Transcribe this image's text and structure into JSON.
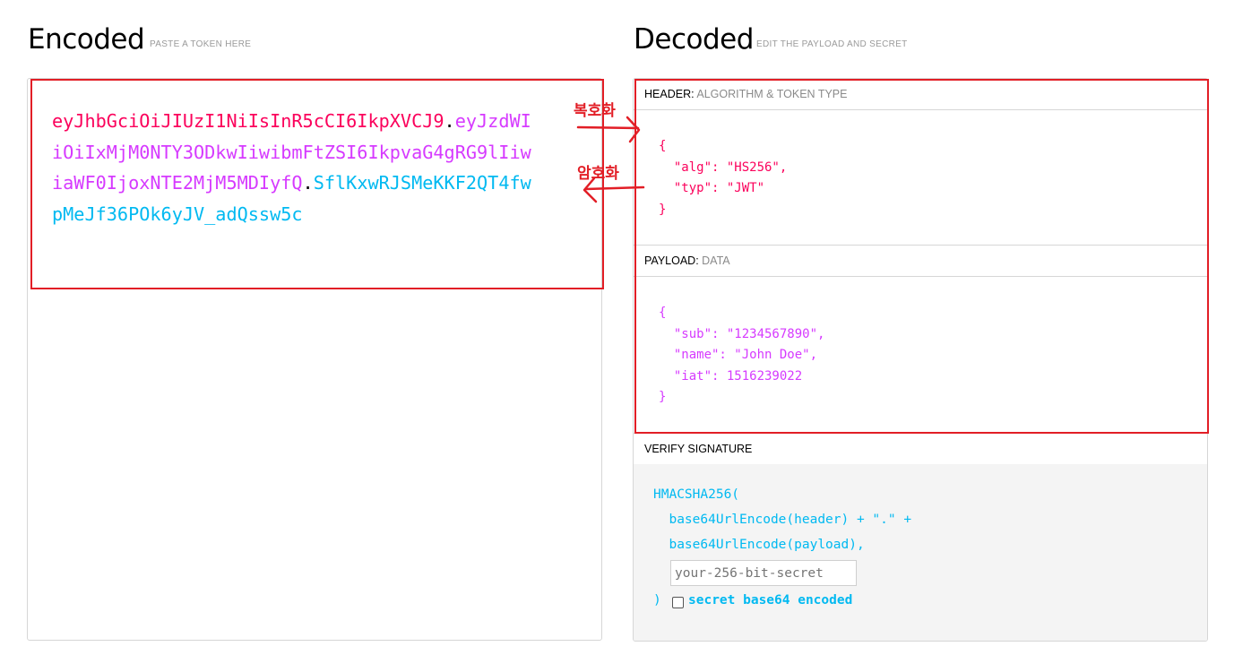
{
  "encoded": {
    "title": "Encoded",
    "subtitle": "PASTE A TOKEN HERE",
    "token": {
      "header_part": "eyJhbGciOiJIUzI1NiIsInR5cCI6IkpXVCJ9",
      "dot1": ".",
      "payload_part": "eyJzdWIiOiIxMjM0NTY3ODkwIiwibmFtZSI6IkpvaG4gRG9lIiwiaWF0IjoxNTE2MjM5MDIyfQ",
      "dot2": ".",
      "signature_part": "SflKxwRJSMeKKF2QT4fwpMeJf36POk6yJV_adQssw5c"
    }
  },
  "decoded": {
    "title": "Decoded",
    "subtitle": "EDIT THE PAYLOAD AND SECRET",
    "header_section": {
      "label": "HEADER:",
      "desc": "ALGORITHM & TOKEN TYPE",
      "json": "{\n  \"alg\": \"HS256\",\n  \"typ\": \"JWT\"\n}"
    },
    "payload_section": {
      "label": "PAYLOAD:",
      "desc": "DATA",
      "json": "{\n  \"sub\": \"1234567890\",\n  \"name\": \"John Doe\",\n  \"iat\": 1516239022\n}"
    },
    "verify_section": {
      "label": "VERIFY SIGNATURE",
      "line1": "HMACSHA256(",
      "line2": "  base64UrlEncode(header) + \".\" +",
      "line3": "  base64UrlEncode(payload),",
      "secret_placeholder": "your-256-bit-secret",
      "close": ")",
      "checkbox_label": "secret base64 encoded"
    }
  },
  "annotations": {
    "decode_label": "복호화",
    "encode_label": "암호화",
    "color": "#e21e26"
  },
  "colors": {
    "header": "#fb015b",
    "payload": "#d63aff",
    "signature": "#00b9f1"
  }
}
